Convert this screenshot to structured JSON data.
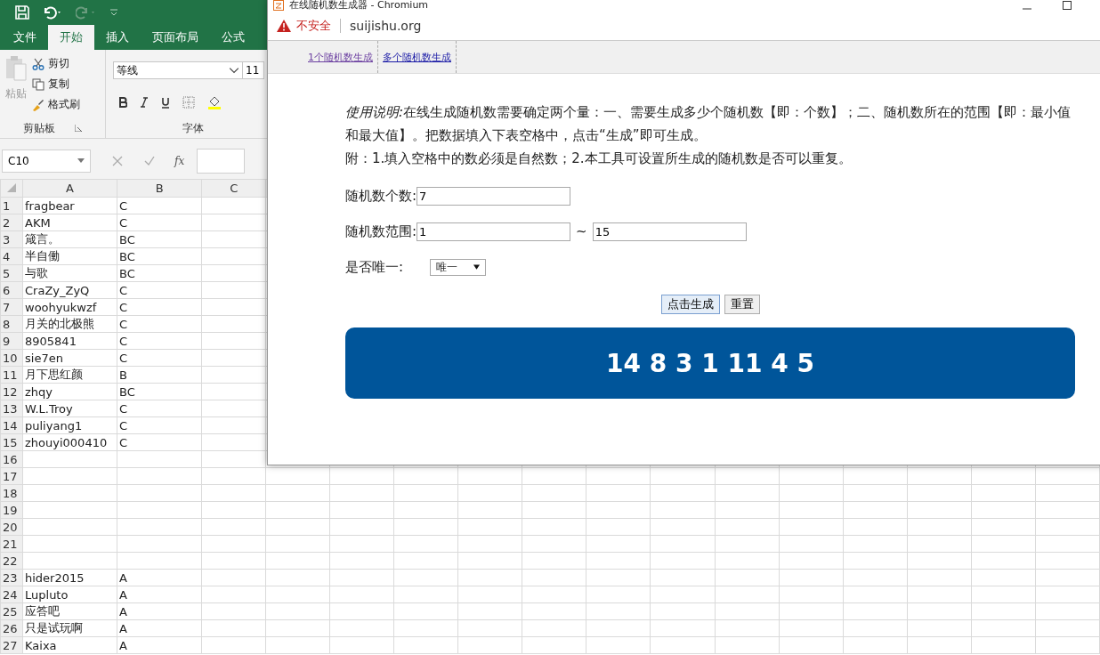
{
  "excel": {
    "ribbon_tabs": [
      {
        "label": "文件",
        "selected": false
      },
      {
        "label": "开始",
        "selected": true
      },
      {
        "label": "插入",
        "selected": false
      },
      {
        "label": "页面布局",
        "selected": false
      },
      {
        "label": "公式",
        "selected": false
      }
    ],
    "clipboard": {
      "paste": "粘贴",
      "disabled": true,
      "cut": "剪切",
      "copy": "复制",
      "painter": "格式刷",
      "group": "剪贴板"
    },
    "font": {
      "name": "等线",
      "size": "11",
      "group": "字体"
    },
    "name_box": "C10",
    "fx": "fx",
    "columns": [
      "A",
      "B",
      "C"
    ],
    "rows": [
      {
        "num": "1",
        "a": "fragbear",
        "b": "C"
      },
      {
        "num": "2",
        "a": "AKM",
        "b": "C"
      },
      {
        "num": "3",
        "a": "箴言。",
        "b": "BC"
      },
      {
        "num": "4",
        "a": "半自働",
        "b": "BC"
      },
      {
        "num": "5",
        "a": "与歌",
        "b": "BC"
      },
      {
        "num": "6",
        "a": "CraZy_ZyQ",
        "b": "C"
      },
      {
        "num": "7",
        "a": "woohyukwzf",
        "b": "C"
      },
      {
        "num": "8",
        "a": "月关的北极熊",
        "b": "C"
      },
      {
        "num": "9",
        "a": "8905841",
        "b": "C"
      },
      {
        "num": "10",
        "a": "sie7en",
        "b": "C"
      },
      {
        "num": "11",
        "a": "月下思红颜",
        "b": "B"
      },
      {
        "num": "12",
        "a": "zhqy",
        "b": "BC"
      },
      {
        "num": "13",
        "a": "W.L.Troy",
        "b": "C"
      },
      {
        "num": "14",
        "a": "puliyang1",
        "b": "C"
      },
      {
        "num": "15",
        "a": "zhouyi000410",
        "b": "C"
      },
      {
        "num": "16"
      },
      {
        "num": "17"
      },
      {
        "num": "18"
      },
      {
        "num": "19"
      },
      {
        "num": "20"
      },
      {
        "num": "21"
      },
      {
        "num": "22"
      },
      {
        "num": "23",
        "a": "hider2015",
        "b": "A"
      },
      {
        "num": "24",
        "a": "Lupluto",
        "b": "A"
      },
      {
        "num": "25",
        "a": "应答吧",
        "b": "A"
      },
      {
        "num": "26",
        "a": "只是试玩啊",
        "b": "A"
      },
      {
        "num": "27",
        "a": "Kaixa",
        "b": "A"
      }
    ]
  },
  "browser": {
    "title": "在线随机数生成器 - Chromium",
    "security": "不安全",
    "url": "suijishu.org",
    "nav": [
      {
        "label": "1个随机数生成",
        "visited": true
      },
      {
        "label": "多个随机数生成",
        "visited": false
      }
    ],
    "intro_label": "使用说明:",
    "intro": "在线生成随机数需要确定两个量：一、需要生成多少个随机数【即：个数】；二、随机数所在的范围【即：最小值和最大值】。把数据填入下表空格中，点击“生成”即可生成。",
    "note": "附：1.填入空格中的数必须是自然数；2.本工具可设置所生成的随机数是否可以重复。",
    "count_label": "随机数个数:",
    "count": "7",
    "range_label": "随机数范围:",
    "min": "1",
    "tilde": "~",
    "max": "15",
    "unique_label": "是否唯一:",
    "unique": "唯一",
    "buttons": [
      {
        "label": "点击生成",
        "focused": true
      },
      {
        "label": "重置",
        "focused": false
      }
    ],
    "result": "14 8 3 1 11 4 5"
  }
}
